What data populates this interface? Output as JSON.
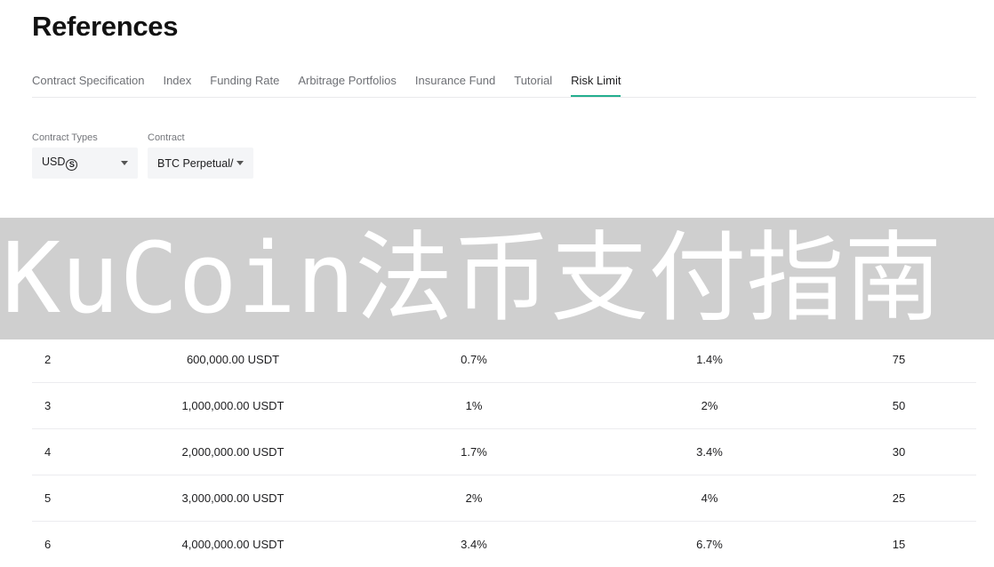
{
  "header": {
    "title": "References"
  },
  "tabs": [
    {
      "label": "Contract Specification"
    },
    {
      "label": "Index"
    },
    {
      "label": "Funding Rate"
    },
    {
      "label": "Arbitrage Portfolios"
    },
    {
      "label": "Insurance Fund"
    },
    {
      "label": "Tutorial"
    },
    {
      "label": "Risk Limit"
    }
  ],
  "active_tab": "Risk Limit",
  "colors": {
    "accent": "#24ae8f",
    "select_bg": "#f4f5f7",
    "banner_bg": "#cfcfcf"
  },
  "filters": {
    "contract_types": {
      "label": "Contract Types",
      "value": "USD",
      "icon": "usdt-coin-icon",
      "icon_glyph": "S"
    },
    "contract": {
      "label": "Contract",
      "value": "BTC Perpetual/"
    }
  },
  "banner": {
    "text": "KuCoin法币支付指南"
  },
  "table": {
    "rows": [
      {
        "level": "2",
        "limit": "600,000.00",
        "unit": "USDT",
        "maint": "0.7%",
        "initial": "1.4%",
        "leverage": "75"
      },
      {
        "level": "3",
        "limit": "1,000,000.00",
        "unit": "USDT",
        "maint": "1%",
        "initial": "2%",
        "leverage": "50"
      },
      {
        "level": "4",
        "limit": "2,000,000.00",
        "unit": "USDT",
        "maint": "1.7%",
        "initial": "3.4%",
        "leverage": "30"
      },
      {
        "level": "5",
        "limit": "3,000,000.00",
        "unit": "USDT",
        "maint": "2%",
        "initial": "4%",
        "leverage": "25"
      },
      {
        "level": "6",
        "limit": "4,000,000.00",
        "unit": "USDT",
        "maint": "3.4%",
        "initial": "6.7%",
        "leverage": "15"
      }
    ]
  }
}
